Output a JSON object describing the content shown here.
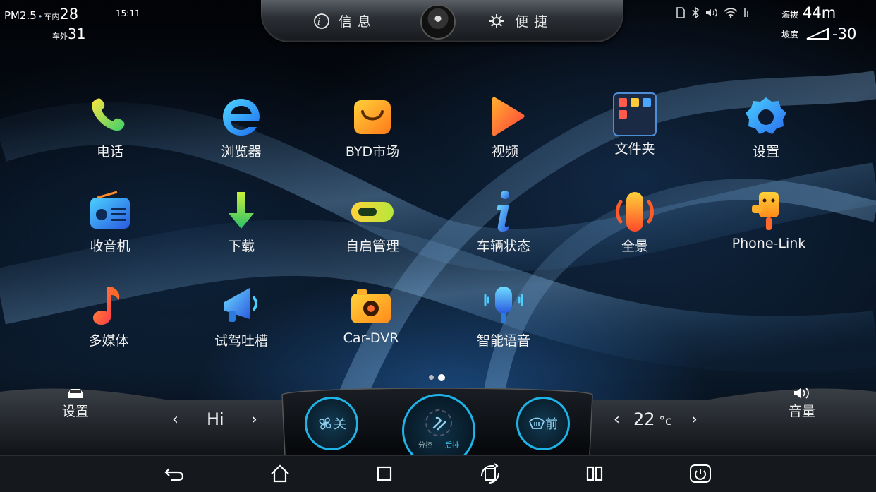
{
  "status": {
    "pm_label": "PM2.5",
    "inside_label": "车内",
    "inside_value": "28",
    "time": "15:11",
    "outside_label": "车外",
    "outside_value": "31",
    "altitude_label": "海拔",
    "altitude_value": "44m",
    "slope_label": "坡度",
    "slope_value": "-30"
  },
  "top_bar": {
    "info_label": "信息",
    "quick_label": "便捷"
  },
  "apps": [
    {
      "label": "电话",
      "icon": "phone-icon"
    },
    {
      "label": "浏览器",
      "icon": "browser-icon"
    },
    {
      "label": "BYD市场",
      "icon": "market-icon"
    },
    {
      "label": "视频",
      "icon": "video-icon"
    },
    {
      "label": "文件夹",
      "icon": "folder-icon"
    },
    {
      "label": "设置",
      "icon": "gear-icon"
    },
    {
      "label": "收音机",
      "icon": "radio-icon"
    },
    {
      "label": "下载",
      "icon": "download-icon"
    },
    {
      "label": "自启管理",
      "icon": "toggle-icon"
    },
    {
      "label": "车辆状态",
      "icon": "info-icon"
    },
    {
      "label": "全景",
      "icon": "panorama-icon"
    },
    {
      "label": "Phone-Link",
      "icon": "phone-link-icon"
    },
    {
      "label": "多媒体",
      "icon": "music-icon"
    },
    {
      "label": "试驾吐槽",
      "icon": "megaphone-icon"
    },
    {
      "label": "Car-DVR",
      "icon": "camera-icon"
    },
    {
      "label": "智能语音",
      "icon": "microphone-icon"
    }
  ],
  "page_indicator": {
    "count": 2,
    "active": 2
  },
  "dock": {
    "settings_label": "设置",
    "fan_level": "Hi",
    "fan_off_label": "关",
    "split_label": "分控",
    "rear_label": "后排",
    "defrost_label": "前",
    "temp_value": "22",
    "temp_unit": "°c",
    "volume_label": "音量"
  },
  "colors": {
    "accent": "#1fb2e6",
    "background": "#06101c"
  }
}
